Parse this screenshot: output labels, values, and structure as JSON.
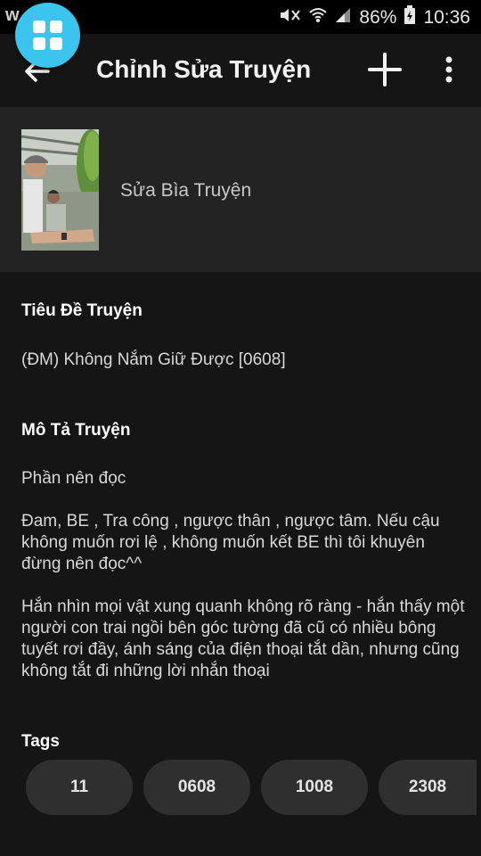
{
  "status_bar": {
    "app_letter": "w",
    "battery_percent": "86%",
    "time": "10:36"
  },
  "header": {
    "title": "Chỉnh Sửa Truyện"
  },
  "cover": {
    "label": "Sửa Bìa Truyện"
  },
  "title_section": {
    "label": "Tiêu Đề Truyện",
    "value": "(ĐM) Không Nắm Giữ Được [0608]"
  },
  "description_section": {
    "label": "Mô Tả Truyện",
    "paragraphs": [
      "Phần nên đọc",
      "Đam, BE , Tra công , ngược thân , ngược tâm.  Nếu cậu không muốn rơi lệ , không muốn kết BE thì tôi khuyên đừng nên đọc^^",
      "Hắn nhìn mọi vật xung quanh không rõ ràng -  hắn thấy một người con trai ngồi bên góc tường đã cũ có nhiều bông tuyết rơi đầy, ánh sáng của điện thoại tắt dần, nhưng cũng không tắt đi những lời nhắn thoại"
    ]
  },
  "tags_section": {
    "label": "Tags",
    "tags": [
      "11",
      "0608",
      "1008",
      "2308"
    ]
  },
  "colors": {
    "fab": "#3ac4ee",
    "background": "#151515",
    "cover_section": "#232323",
    "chip": "#2f2f2f"
  }
}
